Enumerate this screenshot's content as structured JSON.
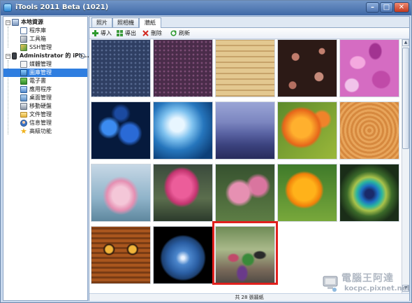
{
  "window": {
    "title": "iTools 2011 Beta (1021)"
  },
  "sidebar": {
    "local_root": "本地資源",
    "local_items": [
      {
        "label": "程序庫",
        "icon": "app-library-icon"
      },
      {
        "label": "工具箱",
        "icon": "toolbox-icon"
      },
      {
        "label": "SSH管理",
        "icon": "ssh-icon"
      }
    ],
    "device_root": "Administrator 的 iPh...",
    "device_items": [
      {
        "label": "媒體管理",
        "icon": "media-icon"
      },
      {
        "label": "圖庫管理",
        "icon": "photo-library-icon"
      },
      {
        "label": "電子書",
        "icon": "ebook-icon"
      },
      {
        "label": "應用程序",
        "icon": "apps-icon"
      },
      {
        "label": "桌面管理",
        "icon": "desktop-icon"
      },
      {
        "label": "移動硬盤",
        "icon": "usb-drive-icon"
      },
      {
        "label": "文件管理",
        "icon": "folder-icon"
      },
      {
        "label": "信息管理",
        "icon": "contacts-icon"
      },
      {
        "label": "高級功能",
        "icon": "star-icon"
      }
    ],
    "selected_index": 1
  },
  "tabs": [
    {
      "label": "照片"
    },
    {
      "label": "照相機"
    },
    {
      "label": "牆紙"
    }
  ],
  "active_tab": 2,
  "toolbar": {
    "import_label": "導入",
    "export_label": "導出",
    "delete_label": "刪除",
    "refresh_label": "刷新"
  },
  "wallpapers": [
    {
      "name": "navy-dots"
    },
    {
      "name": "plum-dots"
    },
    {
      "name": "beige-pattern"
    },
    {
      "name": "brown-flowers"
    },
    {
      "name": "pink-camo"
    },
    {
      "name": "blue-bokeh"
    },
    {
      "name": "blue-wave"
    },
    {
      "name": "purple-mountains"
    },
    {
      "name": "autumn-leaves"
    },
    {
      "name": "wood-rings"
    },
    {
      "name": "water-lily"
    },
    {
      "name": "pink-tulip"
    },
    {
      "name": "pink-roses"
    },
    {
      "name": "orange-poppy"
    },
    {
      "name": "peacock-feather"
    },
    {
      "name": "tiki-carving"
    },
    {
      "name": "earth"
    },
    {
      "name": "family-photo",
      "highlighted": true
    }
  ],
  "status": {
    "text": "共 28 張牆紙"
  },
  "watermark": {
    "text": "電腦王阿達",
    "url": "kocpc.pixnet.net"
  },
  "colors": {
    "selection": "#2f7ee0",
    "highlight_border": "#e0201d",
    "title_bar": "#4f78b4"
  }
}
